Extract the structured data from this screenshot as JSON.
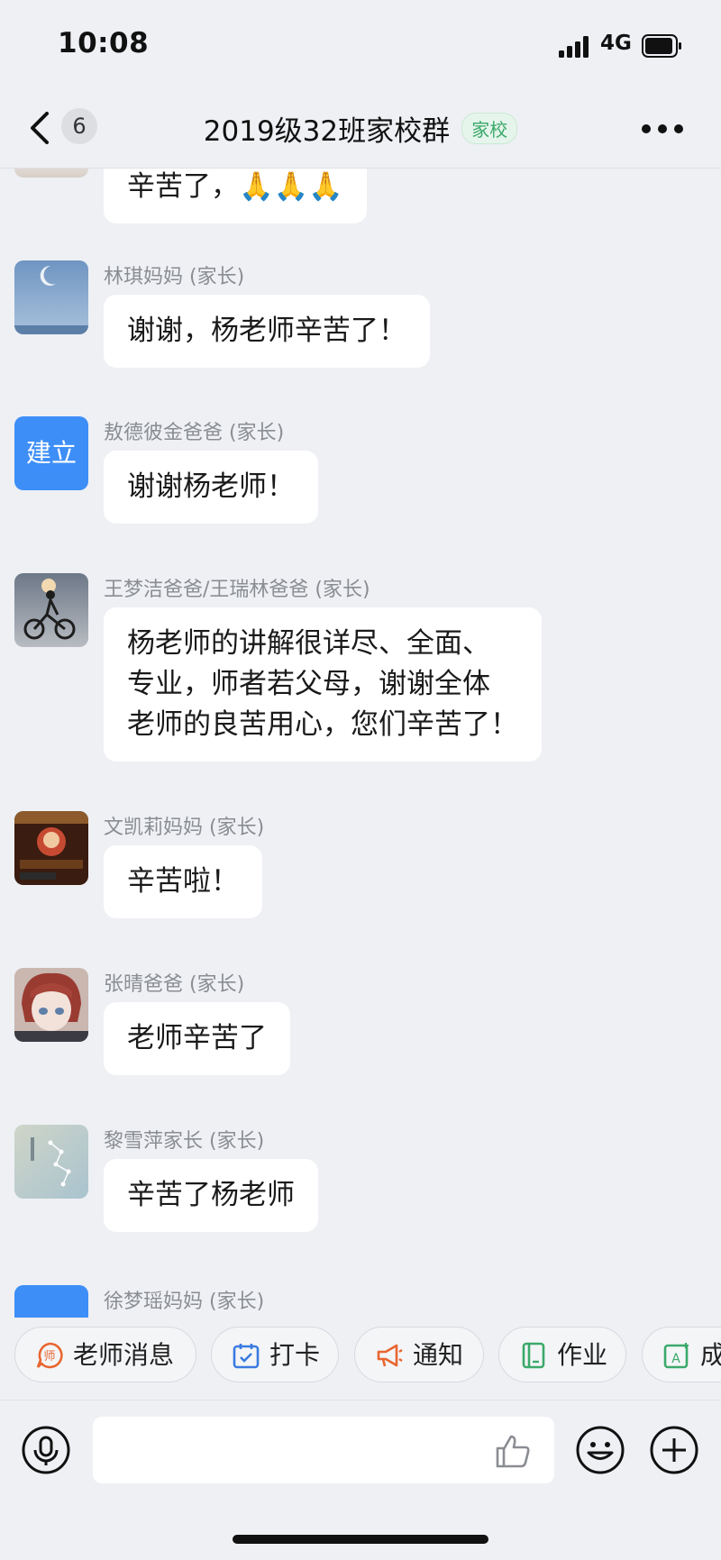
{
  "status_bar": {
    "time": "10:08",
    "network": "4G"
  },
  "nav": {
    "back_count": "6",
    "title": "2019级32班家校群",
    "tag": "家校"
  },
  "messages": [
    {
      "sender": "",
      "text": "辛苦了，🙏🙏🙏",
      "avatar": "partial-avatar"
    },
    {
      "sender": "林琪妈妈 (家长)",
      "text": "谢谢，杨老师辛苦了！",
      "avatar": "moon-sky-avatar"
    },
    {
      "sender": "敖德彼金爸爸 (家长)",
      "text": "谢谢杨老师！",
      "avatar": "建立"
    },
    {
      "sender": "王梦洁爸爸/王瑞林爸爸 (家长)",
      "text": "杨老师的讲解很详尽、全面、\n专业，师者若父母，谢谢全体\n老师的良苦用心，您们辛苦了！",
      "avatar": "cyclist-avatar"
    },
    {
      "sender": "文凯莉妈妈 (家长)",
      "text": "辛苦啦！",
      "avatar": "game-screenshot-avatar"
    },
    {
      "sender": "张晴爸爸 (家长)",
      "text": "老师辛苦了",
      "avatar": "anime-character-avatar"
    },
    {
      "sender": "黎雪萍家长 (家长)",
      "text": "辛苦了杨老师",
      "avatar": "constellation-avatar"
    },
    {
      "sender": "徐梦瑶妈妈 (家长)",
      "text": "",
      "avatar": "blue-avatar"
    }
  ],
  "quick_actions": [
    {
      "label": "老师消息",
      "icon": "teacher-icon",
      "color": "#e8662f"
    },
    {
      "label": "打卡",
      "icon": "checkin-icon",
      "color": "#3a7be0"
    },
    {
      "label": "通知",
      "icon": "megaphone-icon",
      "color": "#e8662f"
    },
    {
      "label": "作业",
      "icon": "homework-icon",
      "color": "#3aa96a"
    },
    {
      "label": "成",
      "icon": "grade-icon",
      "color": "#3aa96a"
    }
  ],
  "input": {
    "placeholder": ""
  },
  "colors": {
    "accent_blue": "#3d8ef7",
    "tag_green": "#3aa96a",
    "background": "#eef0f4"
  }
}
